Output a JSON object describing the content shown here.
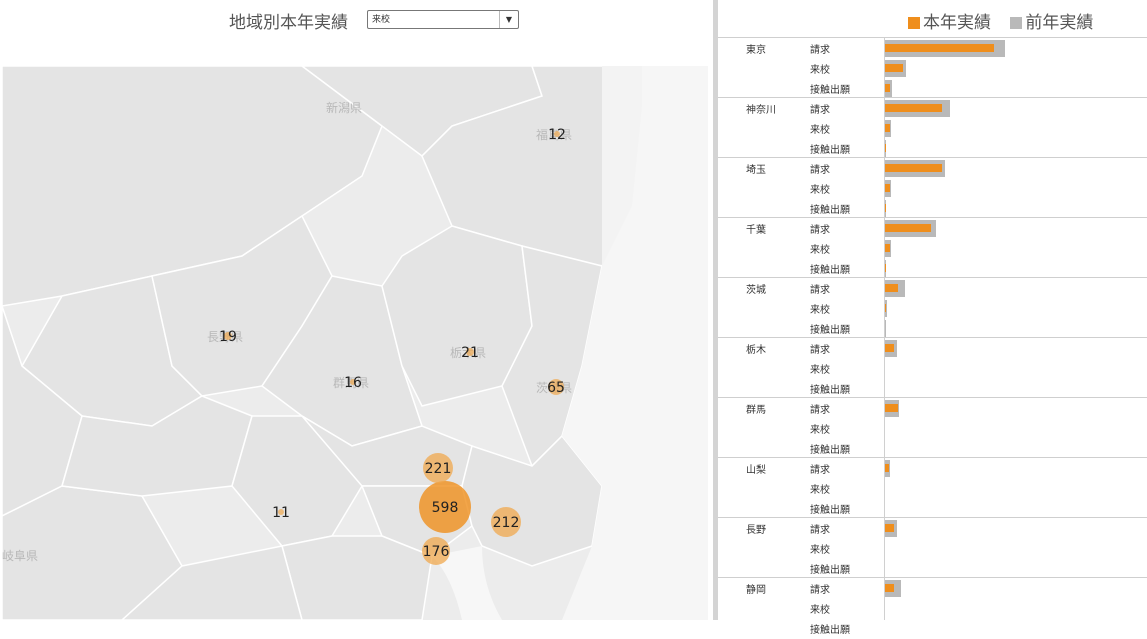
{
  "header": {
    "title": "地域別本年実績",
    "dropdown_value": "来校"
  },
  "legend": {
    "current": "本年実績",
    "previous": "前年実績",
    "current_color": "#ef8e1c",
    "previous_color": "#b9b9b9"
  },
  "map": {
    "labels": [
      "新潟県",
      "福島県",
      "長野県",
      "群馬県",
      "栃木県",
      "茨城県",
      "岐阜県"
    ],
    "bubbles": [
      {
        "pref": "東京",
        "value": "598"
      },
      {
        "pref": "神奈川",
        "value": "176"
      },
      {
        "pref": "埼玉",
        "value": "221"
      },
      {
        "pref": "千葉",
        "value": "212"
      },
      {
        "pref": "茨城",
        "value": "65"
      },
      {
        "pref": "栃木",
        "value": "21"
      },
      {
        "pref": "長野",
        "value": "19"
      },
      {
        "pref": "群馬",
        "value": "16"
      },
      {
        "pref": "福島",
        "value": "12"
      },
      {
        "pref": "山梨",
        "value": "11"
      }
    ]
  },
  "chart_data": {
    "type": "bar",
    "metrics": [
      "請求",
      "来校",
      "接触出願"
    ],
    "series": [
      {
        "name": "本年実績"
      },
      {
        "name": "前年実績"
      }
    ],
    "xlim": [
      0,
      100
    ],
    "groups": [
      {
        "pref": "東京",
        "current": [
          42,
          7,
          2
        ],
        "previous": [
          46,
          8,
          2.5
        ]
      },
      {
        "pref": "神奈川",
        "current": [
          22,
          2,
          0.3
        ],
        "previous": [
          25,
          2.2,
          0.4
        ]
      },
      {
        "pref": "埼玉",
        "current": [
          22,
          2,
          0.3
        ],
        "previous": [
          23,
          2.2,
          0.4
        ]
      },
      {
        "pref": "千葉",
        "current": [
          17.5,
          2,
          0.3
        ],
        "previous": [
          19.5,
          2.2,
          0.4
        ]
      },
      {
        "pref": "茨城",
        "current": [
          5,
          0.5,
          0
        ],
        "previous": [
          7.5,
          0.8,
          0.1
        ]
      },
      {
        "pref": "栃木",
        "current": [
          3.5,
          0,
          0
        ],
        "previous": [
          4.5,
          0,
          0
        ]
      },
      {
        "pref": "群馬",
        "current": [
          5,
          0,
          0
        ],
        "previous": [
          5.5,
          0,
          0
        ]
      },
      {
        "pref": "山梨",
        "current": [
          1.5,
          0,
          0
        ],
        "previous": [
          1.8,
          0,
          0
        ]
      },
      {
        "pref": "長野",
        "current": [
          3.5,
          0,
          0
        ],
        "previous": [
          4.5,
          0,
          0
        ]
      },
      {
        "pref": "静岡",
        "current": [
          3.5,
          0,
          0
        ],
        "previous": [
          6,
          0,
          0
        ]
      }
    ]
  }
}
